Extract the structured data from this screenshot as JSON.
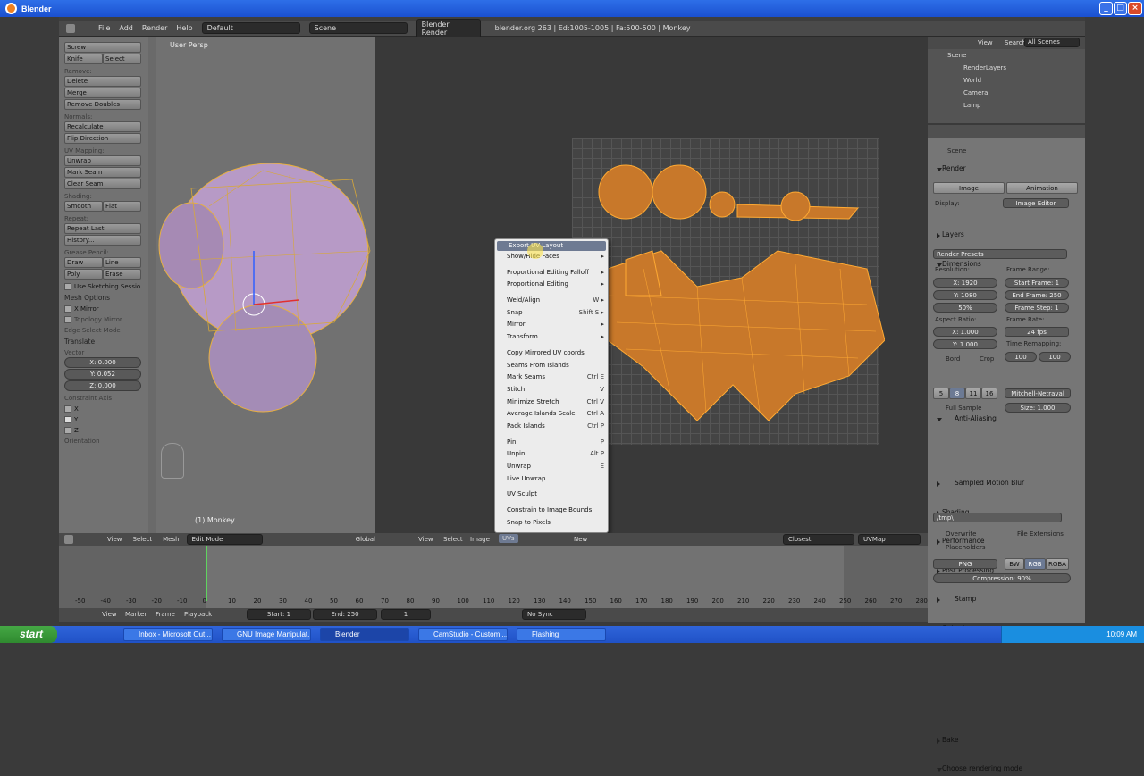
{
  "window": {
    "title": "Blender"
  },
  "menubar": {
    "items": [
      "File",
      "Add",
      "Render",
      "Help"
    ],
    "layout": "Default",
    "scene": "Scene",
    "engine": "Blender Render",
    "stats": "blender.org 263 | Ed:1005-1005 | Fa:500-500 | Monkey"
  },
  "toolshelf": {
    "screw": "Screw",
    "knife": "Knife",
    "select": "Select",
    "remove_label": "Remove:",
    "delete": "Delete",
    "merge": "Merge",
    "remove_doubles": "Remove Doubles",
    "normals_label": "Normals:",
    "recalculate": "Recalculate",
    "flip_direction": "Flip Direction",
    "uv_label": "UV Mapping:",
    "unwrap": "Unwrap",
    "mark_seam": "Mark Seam",
    "clear_seam": "Clear Seam",
    "shading_label": "Shading:",
    "smooth": "Smooth",
    "flat": "Flat",
    "repeat_label": "Repeat:",
    "repeat_last": "Repeat Last",
    "history": "History...",
    "grease_label": "Grease Pencil:",
    "draw": "Draw",
    "line": "Line",
    "poly": "Poly",
    "erase": "Erase",
    "use_sketching": "Use Sketching Sessio",
    "mesh_options": "Mesh Options",
    "x_mirror": "X Mirror",
    "topology_mirror": "Topology Mirror",
    "edge_select_mode": "Edge Select Mode",
    "translate": "Translate",
    "vector_label": "Vector",
    "vx": "X: 0.000",
    "vy": "Y: 0.052",
    "vz": "Z: 0.000",
    "constraint_label": "Constraint Axis",
    "cx": "X",
    "cy": "Y",
    "cz": "Z",
    "orientation": "Orientation"
  },
  "viewport": {
    "label": "User Persp",
    "object": "(1) Monkey"
  },
  "uv_menu": {
    "items": [
      {
        "label": "Export UV Layout",
        "shortcut": ""
      },
      {
        "label": "Show/Hide Faces",
        "shortcut": "▸"
      },
      {
        "label": "Proportional Editing Falloff",
        "shortcut": "▸"
      },
      {
        "label": "Proportional Editing",
        "shortcut": "▸"
      },
      {
        "label": "Weld/Align",
        "shortcut": "W ▸"
      },
      {
        "label": "Snap",
        "shortcut": "Shift S ▸"
      },
      {
        "label": "Mirror",
        "shortcut": "▸"
      },
      {
        "label": "Transform",
        "shortcut": "▸"
      },
      {
        "label": "Copy Mirrored UV coords",
        "shortcut": ""
      },
      {
        "label": "Seams From Islands",
        "shortcut": ""
      },
      {
        "label": "Mark Seams",
        "shortcut": "Ctrl E"
      },
      {
        "label": "Stitch",
        "shortcut": "V"
      },
      {
        "label": "Minimize Stretch",
        "shortcut": "Ctrl V"
      },
      {
        "label": "Average Islands Scale",
        "shortcut": "Ctrl A"
      },
      {
        "label": "Pack Islands",
        "shortcut": "Ctrl P"
      },
      {
        "label": "Pin",
        "shortcut": "P"
      },
      {
        "label": "Unpin",
        "shortcut": "Alt P"
      },
      {
        "label": "Unwrap",
        "shortcut": "E"
      },
      {
        "label": "Live Unwrap",
        "shortcut": ""
      },
      {
        "label": "UV Sculpt",
        "shortcut": ""
      },
      {
        "label": "Constrain to Image Bounds",
        "shortcut": ""
      },
      {
        "label": "Snap to Pixels",
        "shortcut": ""
      }
    ]
  },
  "outliner": {
    "view": "View",
    "search": "Search",
    "scope": "All Scenes",
    "items": [
      "Scene",
      "RenderLayers",
      "World",
      "Camera",
      "Lamp"
    ]
  },
  "properties": {
    "scene": "Scene",
    "render": "Render",
    "image_btn": "Image",
    "animation_btn": "Animation",
    "display_label": "Display:",
    "display_value": "Image Editor",
    "layers": "Layers",
    "dimensions": "Dimensions",
    "presets": "Render Presets",
    "resolution": "Resolution:",
    "res_x": "X: 1920",
    "res_y": "Y: 1080",
    "res_pct": "50%",
    "frame_range": "Frame Range:",
    "start_frame": "Start Frame: 1",
    "end_frame": "End Frame: 250",
    "frame_step": "Frame Step: 1",
    "aspect": "Aspect Ratio:",
    "asp_x": "X: 1.000",
    "asp_y": "Y: 1.000",
    "frame_rate": "Frame Rate:",
    "fps": "24 fps",
    "time_remap": "Time Remapping:",
    "remap_a": "100",
    "remap_b": "100",
    "bord": "Bord",
    "crop": "Crop",
    "anti_aliasing": "Anti-Aliasing",
    "aa5": "5",
    "aa8": "8",
    "aa11": "11",
    "aa16": "16",
    "aa_filter": "Mitchell-Netraval",
    "full_sample": "Full Sample",
    "size": "Size: 1.000",
    "motion_blur": "Sampled Motion Blur",
    "shading": "Shading",
    "performance": "Performance",
    "post_processing": "Post Processing",
    "stamp": "Stamp",
    "output": "Output",
    "path": "/tmp\\",
    "overwrite": "Overwrite",
    "file_ext": "File Extensions",
    "placeholders": "Placeholders",
    "format": "PNG",
    "bw": "BW",
    "rgb": "RGB",
    "rgba": "RGBA",
    "compression": "Compression: 90%",
    "bake": "Bake",
    "choose_render_mode": "Choose rendering mode"
  },
  "header3d": {
    "view": "View",
    "select": "Select",
    "mesh": "Mesh",
    "mode": "Edit Mode",
    "global": "Global"
  },
  "headeruv": {
    "view": "View",
    "select": "Select",
    "image": "Image",
    "uvs": "UVs",
    "new": "New",
    "pivot": "Closest",
    "uvmap": "UVMap"
  },
  "timeline": {
    "ticks": [
      "-50",
      "-40",
      "-30",
      "-20",
      "-10",
      "0",
      "10",
      "20",
      "30",
      "40",
      "50",
      "60",
      "70",
      "80",
      "90",
      "100",
      "110",
      "120",
      "130",
      "140",
      "150",
      "160",
      "170",
      "180",
      "190",
      "200",
      "210",
      "220",
      "230",
      "240",
      "250",
      "260",
      "270",
      "280"
    ],
    "view": "View",
    "marker": "Marker",
    "frame": "Frame",
    "playback": "Playback",
    "start": "Start: 1",
    "end": "End: 250",
    "current": "1",
    "sync": "No Sync"
  },
  "taskbar": {
    "start": "start",
    "tasks": [
      "Inbox - Microsoft Out...",
      "GNU Image Manipulat...",
      "Blender",
      "CamStudio - Custom ...",
      "Flashing"
    ],
    "clock": "10:09 AM"
  },
  "colors": {
    "uv_face": "#c8782a",
    "uv_edge": "#ffaa33",
    "mesh_face": "#b79ac6",
    "titlebar": "#2e6fe8"
  }
}
